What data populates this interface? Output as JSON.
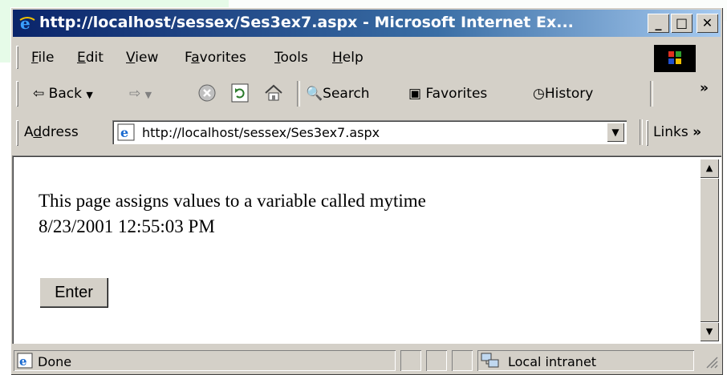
{
  "window": {
    "title": "http://localhost/sessex/Ses3ex7.aspx - Microsoft Internet Ex...",
    "minimize": "_",
    "maximize": "□",
    "close": "✕"
  },
  "menu": {
    "items": [
      {
        "label": "File",
        "accel": "F",
        "rest": "ile"
      },
      {
        "label": "Edit",
        "accel": "E",
        "rest": "dit"
      },
      {
        "label": "View",
        "accel": "V",
        "rest": "iew"
      },
      {
        "label": "Favorites",
        "pre": "F",
        "accel": "a",
        "rest": "vorites"
      },
      {
        "label": "Tools",
        "accel": "T",
        "rest": "ools"
      },
      {
        "label": "Help",
        "accel": "H",
        "rest": "elp"
      }
    ]
  },
  "toolbar": {
    "back_label": "Back",
    "search_label": "Search",
    "favorites_label": "Favorites",
    "history_label": "History",
    "more_label": "»"
  },
  "address": {
    "label_pre": "A",
    "label_accel": "d",
    "label_rest": "dress",
    "url": "http://localhost/sessex/Ses3ex7.aspx",
    "links_label": "Links",
    "links_more": "»"
  },
  "page": {
    "line1": "This page assigns values to a variable called mytime",
    "line2": "8/23/2001 12:55:03 PM",
    "button_label": "Enter"
  },
  "status": {
    "text": "Done",
    "zone": "Local intranet"
  },
  "colors": {
    "title_gradient_start": "#0a246a",
    "title_gradient_end": "#a6caf0",
    "chrome": "#d4d0c8",
    "background_band": "#e6fbe8"
  }
}
